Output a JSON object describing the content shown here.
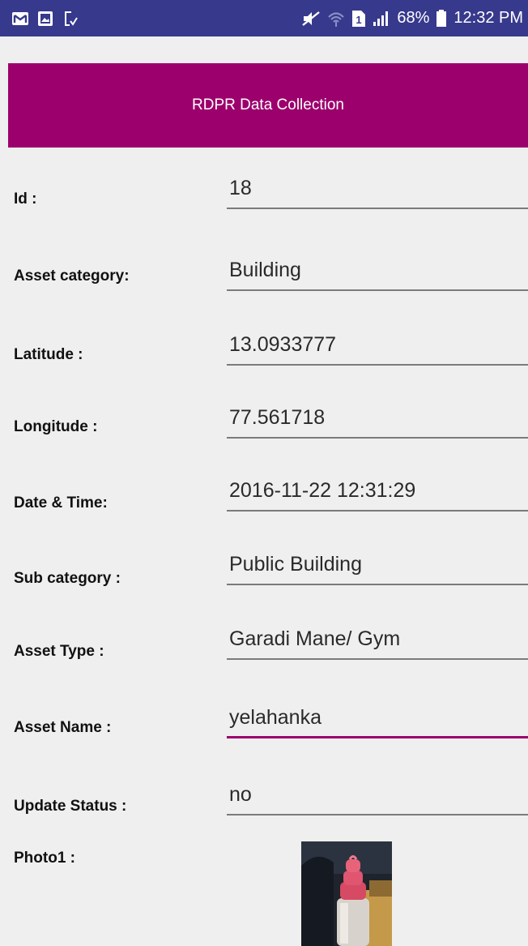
{
  "status_bar": {
    "battery": "68%",
    "time": "12:32 PM",
    "sim_slot": "1",
    "icons_left": [
      "gmail-icon",
      "gallery-icon",
      "screenshot-icon"
    ],
    "icons_right": [
      "mute-icon",
      "wifi-icon",
      "sim-icon",
      "signal-icon",
      "battery-icon"
    ]
  },
  "app_bar": {
    "title": "RDPR Data Collection",
    "color": "#9c006c"
  },
  "form": {
    "id": {
      "label": "Id :",
      "value": "18"
    },
    "asset_category": {
      "label": "Asset category:",
      "value": "Building"
    },
    "latitude": {
      "label": "Latitude :",
      "value": "13.0933777"
    },
    "longitude": {
      "label": "Longitude :",
      "value": "77.561718"
    },
    "date_time": {
      "label": "Date & Time:",
      "value": "2016-11-22 12:31:29"
    },
    "sub_category": {
      "label": "Sub category  :",
      "value": "Public Building"
    },
    "asset_type": {
      "label": "Asset Type :",
      "value": "Garadi Mane/ Gym"
    },
    "asset_name": {
      "label": "Asset Name :",
      "value": "yelahanka"
    },
    "update_status": {
      "label": "Update Status :",
      "value": "no"
    },
    "photo1": {
      "label": "Photo1 :"
    }
  }
}
